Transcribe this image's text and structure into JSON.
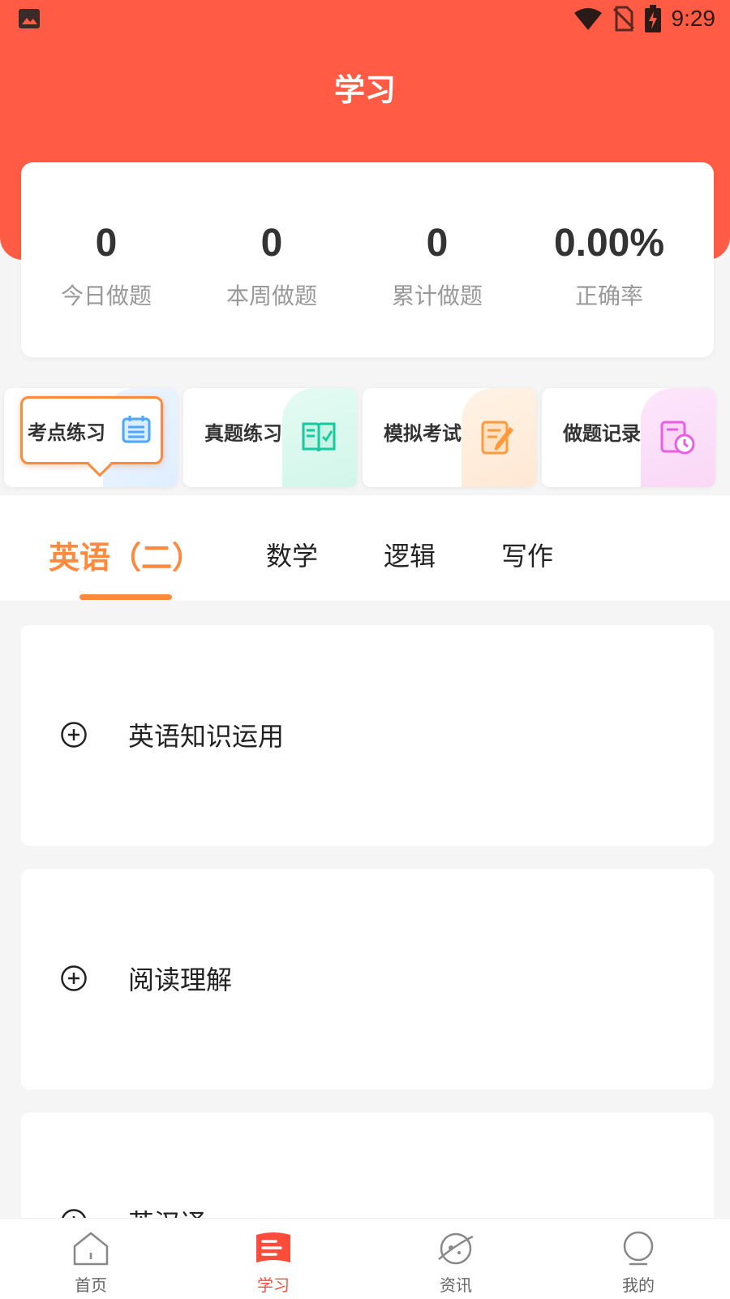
{
  "status_bar": {
    "time": "9:29"
  },
  "header": {
    "title": "学习"
  },
  "stats": [
    {
      "value": "0",
      "label": "今日做题"
    },
    {
      "value": "0",
      "label": "本周做题"
    },
    {
      "value": "0",
      "label": "累计做题"
    },
    {
      "value": "0.00%",
      "label": "正确率"
    }
  ],
  "quick_actions": [
    {
      "label": "考点练习",
      "icon": "calendar-list-icon",
      "color": "#4ea6ff"
    },
    {
      "label": "真题练习",
      "icon": "book-icon",
      "color": "#18c9a0"
    },
    {
      "label": "模拟考试",
      "icon": "edit-note-icon",
      "color": "#ff9a3c"
    },
    {
      "label": "做题记录",
      "icon": "record-clock-icon",
      "color": "#e85fe0"
    }
  ],
  "subject_tabs": [
    {
      "label": "英语（二）",
      "active": true
    },
    {
      "label": "数学",
      "active": false
    },
    {
      "label": "逻辑",
      "active": false
    },
    {
      "label": "写作",
      "active": false
    }
  ],
  "sections": [
    {
      "title": "英语知识运用"
    },
    {
      "title": "阅读理解"
    },
    {
      "title": "英汉译"
    }
  ],
  "bottom_nav": [
    {
      "label": "首页",
      "icon": "home-icon",
      "active": false
    },
    {
      "label": "学习",
      "icon": "study-book-icon",
      "active": true
    },
    {
      "label": "资讯",
      "icon": "planet-icon",
      "active": false
    },
    {
      "label": "我的",
      "icon": "profile-icon",
      "active": false
    }
  ],
  "colors": {
    "header": "#ff5b45",
    "accent": "#ff8a3d",
    "nav_active": "#ff4b3a"
  }
}
